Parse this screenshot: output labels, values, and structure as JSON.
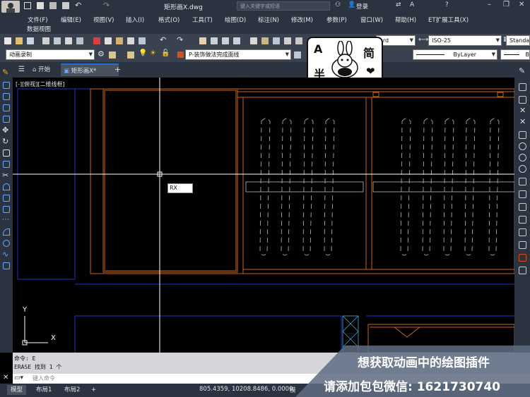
{
  "title": {
    "filename": "矩形画X.dwg",
    "search_placeholder": "键入关键字或短语",
    "login": "登录"
  },
  "menu": {
    "items": [
      "文件(F)",
      "编辑(E)",
      "视图(V)",
      "插入(I)",
      "格式(O)",
      "工具(T)",
      "绘图(D)",
      "标注(N)",
      "修改(M)",
      "参数(P)",
      "窗口(W)",
      "帮助(H)",
      "ET扩展工具(X)"
    ],
    "second_row": "数据视图"
  },
  "toolbar1": {
    "text_style": "ard",
    "dim_style": "ISO-25",
    "table_style": "Standa"
  },
  "toolbar2": {
    "workspace": "动画录制",
    "layer": "P-装饰做法完成面线",
    "linetype": "ByLayer",
    "lineweight": "By"
  },
  "tabs": {
    "start": "开始",
    "drawing": "矩形画X*"
  },
  "viewport_label": "[-][俯视][二维线框]",
  "cursor_input": "RX",
  "ucs": {
    "y": "Y",
    "x": "X"
  },
  "command": {
    "line1": "命令: E",
    "line2": "ERASE 找到 1 个",
    "input_placeholder": "键入命令"
  },
  "status": {
    "model_tab": "模型",
    "layout1": "布局1",
    "layout2": "布局2",
    "add_tab": "+",
    "coords": "805.4359, 10208.8486, 0.0000",
    "model_indicator": "模"
  },
  "promo": {
    "line1": "想获取动画中的绘图插件",
    "line2": "请添加包包微信: 1621730740"
  },
  "sticker": {
    "top_left": "A",
    "top_right": "简",
    "bottom_left": "半"
  },
  "colors": {
    "accent": "#1f6fd6",
    "drawing_orange": "#c8641e",
    "drawing_blue": "#2330c8",
    "crosshair": "#ffffff",
    "layer_swatch": "#e04b1a"
  }
}
